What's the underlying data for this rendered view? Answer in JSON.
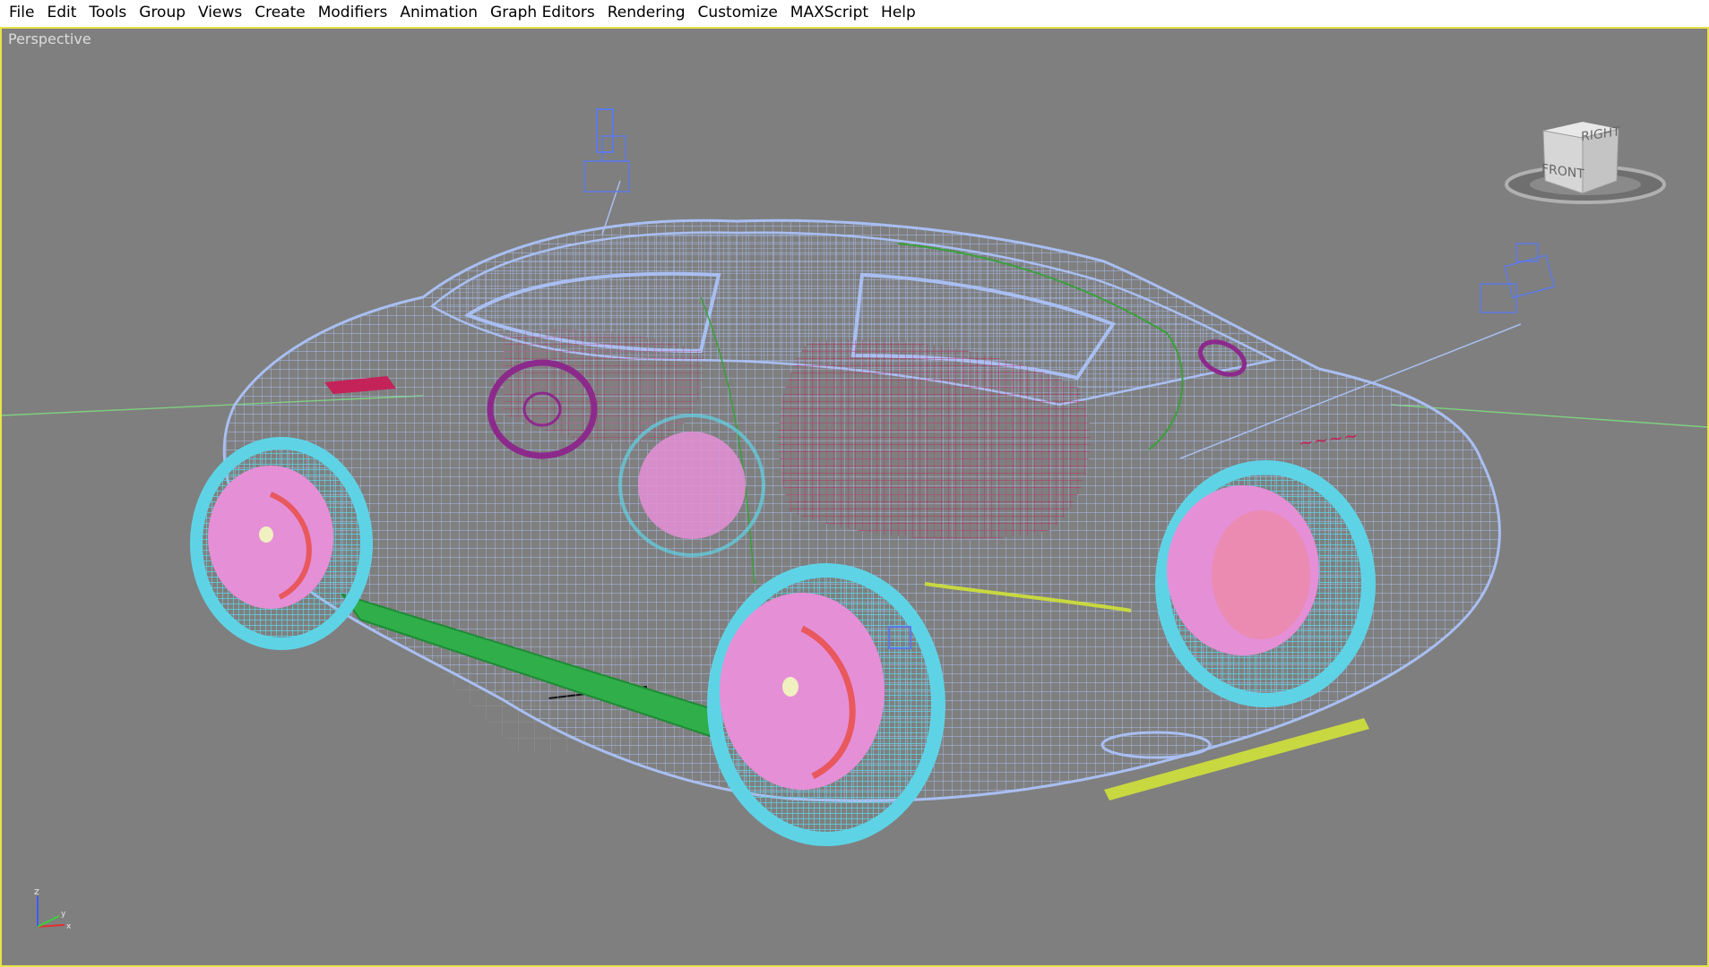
{
  "menu": {
    "items": [
      "File",
      "Edit",
      "Tools",
      "Group",
      "Views",
      "Create",
      "Modifiers",
      "Animation",
      "Graph Editors",
      "Rendering",
      "Customize",
      "MAXScript",
      "Help"
    ]
  },
  "viewport": {
    "label": "Perspective",
    "border_color": "#e6e24a",
    "background": "#7f7f7f"
  },
  "viewcube": {
    "front_label": "FRONT",
    "right_label": "RIGHT"
  },
  "axis": {
    "z_label": "z",
    "x_label": "x",
    "y_label": "y"
  },
  "colors": {
    "wireframe_body": "#a9bff2",
    "wheel_tire": "#5fd3e6",
    "wheel_rim": "#e58fd7",
    "brake": "#e8585c",
    "interior_red": "#c4235a",
    "interior_green": "#3aa038",
    "side_skirt": "#2fae4a",
    "camera": "#5d79e6",
    "grid_green": "#7fd07f",
    "bottom_strip": "#c8d840",
    "steering": "#8c2a8c"
  },
  "icons": {
    "camera_top": "camera-icon",
    "camera_right": "camera-icon",
    "viewcube": "viewcube-icon",
    "axis": "axis-tripod-icon"
  }
}
